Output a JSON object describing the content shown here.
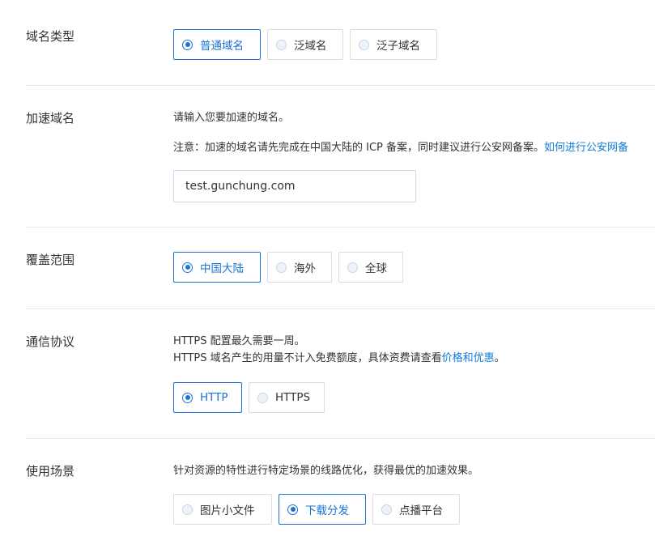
{
  "domain_type": {
    "label": "域名类型",
    "options": [
      {
        "label": "普通域名",
        "selected": true
      },
      {
        "label": "泛域名",
        "selected": false
      },
      {
        "label": "泛子域名",
        "selected": false
      }
    ]
  },
  "acceleration_domain": {
    "label": "加速域名",
    "hint": "请输入您要加速的域名。",
    "notice": "注意：加速的域名请先完成在中国大陆的 ICP 备案，同时建议进行公安网备案。",
    "notice_link": "如何进行公安网备",
    "input_value": "test.gunchung.com"
  },
  "coverage": {
    "label": "覆盖范围",
    "options": [
      {
        "label": "中国大陆",
        "selected": true
      },
      {
        "label": "海外",
        "selected": false
      },
      {
        "label": "全球",
        "selected": false
      }
    ]
  },
  "protocol": {
    "label": "通信协议",
    "line1": "HTTPS 配置最久需要一周。",
    "line2": "HTTPS 域名产生的用量不计入免费额度，具体资费请查看",
    "line2_link": "价格和优惠",
    "line2_end": "。",
    "options": [
      {
        "label": "HTTP",
        "selected": true
      },
      {
        "label": "HTTPS",
        "selected": false
      }
    ]
  },
  "scenario": {
    "label": "使用场景",
    "hint": "针对资源的特性进行特定场景的线路优化，获得最优的加速效果。",
    "options": [
      {
        "label": "图片小文件",
        "selected": false
      },
      {
        "label": "下载分发",
        "selected": true
      },
      {
        "label": "点播平台",
        "selected": false
      }
    ]
  },
  "colors": {
    "accent": "#1b73d5",
    "link": "#0f7ad8",
    "divider": "#e8e8e8",
    "border": "#dcdcdc"
  }
}
